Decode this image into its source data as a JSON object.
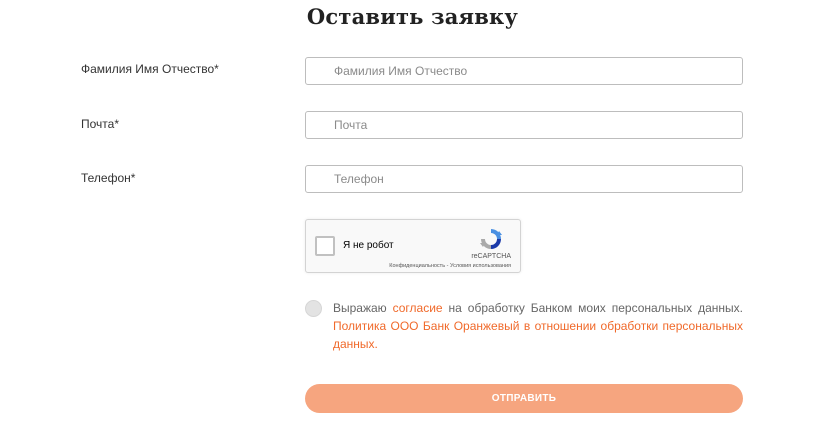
{
  "form": {
    "title": "Оставить заявку",
    "fields": [
      {
        "label": "Фамилия Имя Отчество*",
        "placeholder": "Фамилия Имя Отчество",
        "value": ""
      },
      {
        "label": "Почта*",
        "placeholder": "Почта",
        "value": ""
      },
      {
        "label": "Телефон*",
        "placeholder": "Телефон",
        "value": ""
      }
    ],
    "recaptcha": {
      "label": "Я не робот",
      "brand": "reCAPTCHA",
      "links": "Конфиденциальность - Условия использования",
      "checked": false
    },
    "consent": {
      "line1_before": "Выражаю",
      "line1_link": "согласие",
      "line1_after": "на обработку Банком моих персональных данных.",
      "policy_line1": "Политика ООО Банк Оранжевый в отношении обработки персональных",
      "policy_line2": "данных.",
      "checked": false
    },
    "submit_label": "ОТПРАВИТЬ"
  },
  "colors": {
    "accent": "#f0692a",
    "submit_bg": "#f6a57f",
    "border": "#bdbdbd"
  }
}
